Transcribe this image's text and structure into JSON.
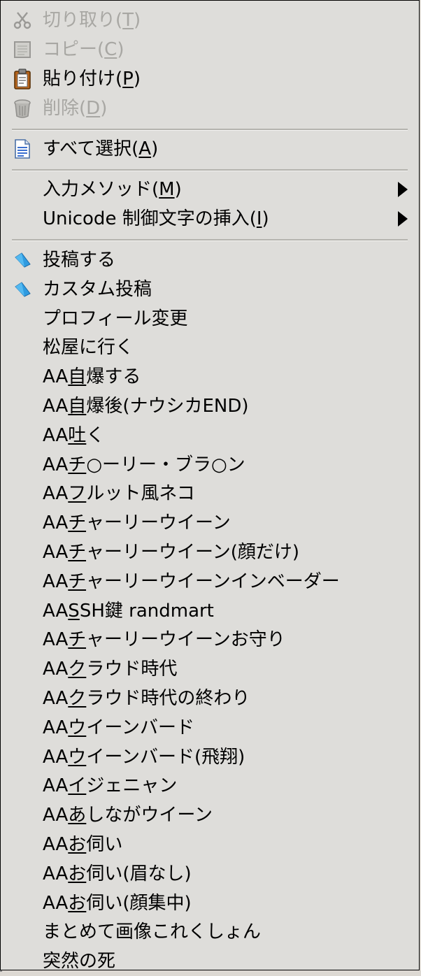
{
  "menu": {
    "edit": [
      {
        "pre": "切り取り(",
        "mn": "T",
        "post": ")",
        "icon": "scissors-icon",
        "disabled": true
      },
      {
        "pre": "コピー(",
        "mn": "C",
        "post": ")",
        "icon": "copy-icon",
        "disabled": true
      },
      {
        "pre": "貼り付け(",
        "mn": "P",
        "post": ")",
        "icon": "clipboard-paste-icon",
        "disabled": false
      },
      {
        "pre": "削除(",
        "mn": "D",
        "post": ")",
        "icon": "trash-icon",
        "disabled": true
      }
    ],
    "select_all": {
      "pre": "すべて選択(",
      "mn": "A",
      "post": ")",
      "icon": "document-select-all-icon"
    },
    "input": [
      {
        "pre": "入力メソッド(",
        "mn": "M",
        "post": ")"
      },
      {
        "pre": "Unicode 制御文字の挿入(",
        "mn": "I",
        "post": ")"
      }
    ],
    "custom": [
      {
        "pre": "",
        "mn": "",
        "post": "投稿する",
        "icon": "blue-pin-icon"
      },
      {
        "pre": "",
        "mn": "",
        "post": "カスタム投稿",
        "icon": "blue-pin-icon"
      },
      {
        "pre": "",
        "mn": "",
        "post": "プロフィール変更"
      },
      {
        "pre": "",
        "mn": "",
        "post": "松屋に行く"
      },
      {
        "pre": "AA",
        "mn": "自",
        "post": "爆する"
      },
      {
        "pre": "AA",
        "mn": "自",
        "post": "爆後(ナウシカEND)"
      },
      {
        "pre": "AA",
        "mn": "吐",
        "post": "く"
      },
      {
        "pre": "AA",
        "mn": "チ",
        "post": "○ーリー・ブラ○ン"
      },
      {
        "pre": "AA",
        "mn": "フ",
        "post": "ルット風ネコ"
      },
      {
        "pre": "AA",
        "mn": "チ",
        "post": "ャーリーウイーン"
      },
      {
        "pre": "AA",
        "mn": "チ",
        "post": "ャーリーウイーン(顔だけ)"
      },
      {
        "pre": "AA",
        "mn": "チ",
        "post": "ャーリーウイーンインベーダー"
      },
      {
        "pre": "AA",
        "mn": "S",
        "post": "SH鍵 randmart"
      },
      {
        "pre": "AA",
        "mn": "チ",
        "post": "ャーリーウイーンお守り"
      },
      {
        "pre": "AA",
        "mn": "ク",
        "post": "ラウド時代"
      },
      {
        "pre": "AA",
        "mn": "ク",
        "post": "ラウド時代の終わり"
      },
      {
        "pre": "AA",
        "mn": "ウ",
        "post": "イーンバード"
      },
      {
        "pre": "AA",
        "mn": "ウ",
        "post": "イーンバード(飛翔)"
      },
      {
        "pre": "AA",
        "mn": "イ",
        "post": "ジェニャン"
      },
      {
        "pre": "AA",
        "mn": "あ",
        "post": "しながウイーン"
      },
      {
        "pre": "AA",
        "mn": "お",
        "post": "伺い"
      },
      {
        "pre": "AA",
        "mn": "お",
        "post": "伺い(眉なし)"
      },
      {
        "pre": "AA",
        "mn": "お",
        "post": "伺い(顔集中)"
      },
      {
        "pre": "",
        "mn": "",
        "post": "まとめて画像これくしょん"
      },
      {
        "pre": "",
        "mn": "",
        "post": "突然の死"
      }
    ]
  }
}
